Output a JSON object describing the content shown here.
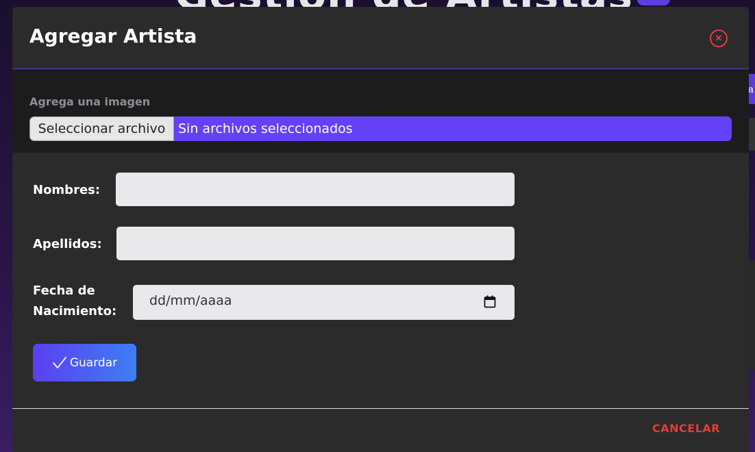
{
  "background": {
    "title": "Gestión de Artistas",
    "side_tab": "a"
  },
  "modal": {
    "title": "Agregar Artista",
    "close_icon": "close-circle-icon",
    "upload": {
      "label": "Agrega una imagen",
      "button_label": "Seleccionar archivo",
      "status": "Sin archivos seleccionados"
    },
    "form": {
      "nombres_label": "Nombres:",
      "nombres_value": "",
      "apellidos_label": "Apellidos:",
      "apellidos_value": "",
      "fecha_label_line1": "Fecha de",
      "fecha_label_line2": "Nacimiento:",
      "fecha_placeholder": "dd/mm/aaaa",
      "save_label": "Guardar"
    },
    "cancel_label": "CANCELAR"
  },
  "colors": {
    "accent": "#6541f5",
    "danger": "#e53c3c",
    "modal_bg": "#2b2b2b"
  }
}
